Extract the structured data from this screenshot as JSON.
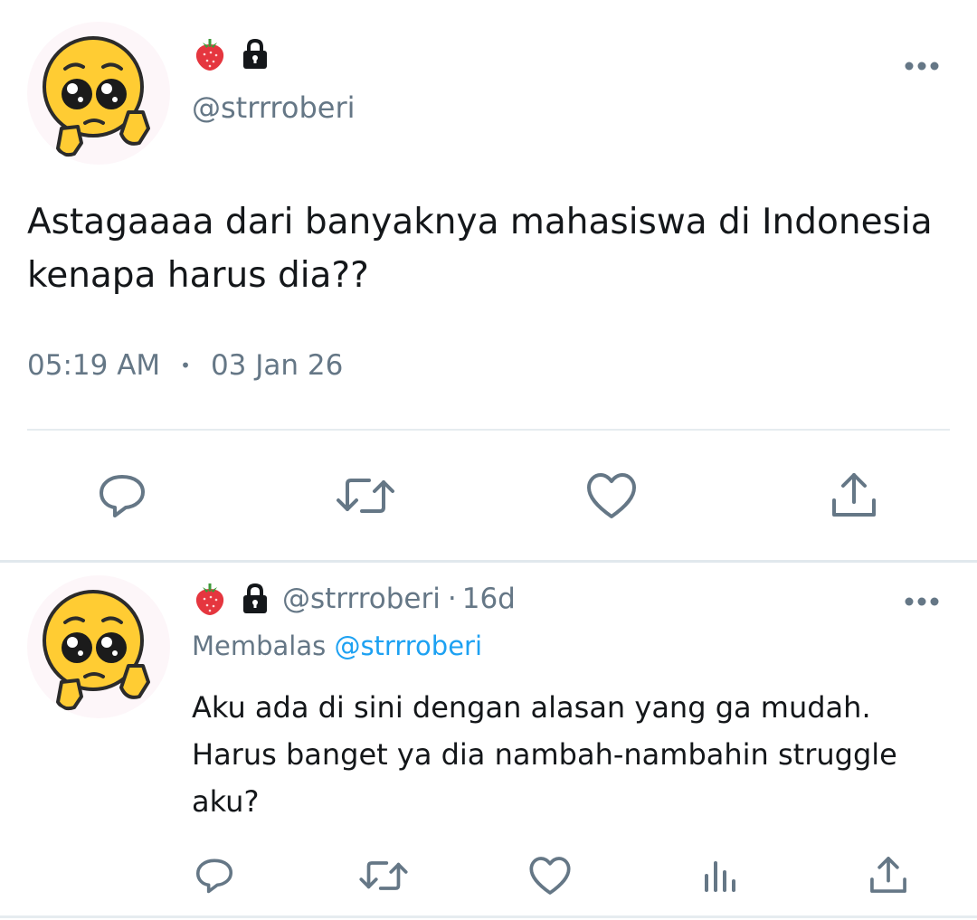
{
  "main_tweet": {
    "handle": "@strrroberi",
    "text": "Astagaaaa dari banyaknya mahasiswa di Indonesia kenapa harus dia??",
    "time": "05:19 AM",
    "separator": "•",
    "date": "03 Jan 26",
    "actions": [
      "reply-icon",
      "retweet-icon",
      "like-icon",
      "share-icon"
    ]
  },
  "reply_tweet": {
    "handle": "@strrroberi",
    "age": "16d",
    "age_separator": "·",
    "replying_label": "Membalas",
    "replying_to": "@strrroberi",
    "text": "Aku ada di sini dengan alasan yang ga mudah. Harus banget ya dia nambah-nambahin struggle aku?",
    "actions": [
      "reply-icon",
      "retweet-icon",
      "like-icon",
      "stats-icon",
      "share-icon"
    ]
  },
  "colors": {
    "text": "#14171a",
    "secondary": "#657786",
    "link": "#1da1f2",
    "divider": "#e6ecf0",
    "strawberry": "#e5363f",
    "emoji_face": "#ffcc33"
  }
}
